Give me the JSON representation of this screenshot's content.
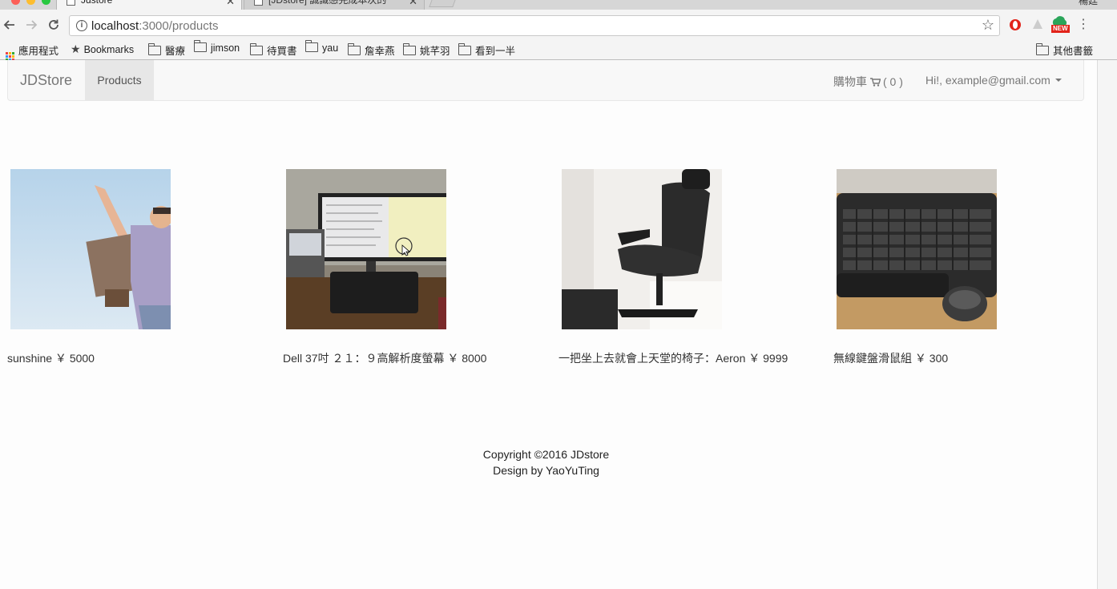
{
  "browser": {
    "tabs": [
      {
        "title": "Jdstore",
        "active": true
      },
      {
        "title": "[JDstore] 誠識感完成本次的",
        "active": false
      }
    ],
    "profile_label": "楊廷",
    "url_host": "localhost",
    "url_path": ":3000/products",
    "bookmarks": [
      {
        "label": "應用程式",
        "icon": "apps-icon"
      },
      {
        "label": "Bookmarks",
        "icon": "star-icon"
      },
      {
        "label": "醫療",
        "icon": "folder-icon"
      },
      {
        "label": "jimson",
        "icon": "folder-icon"
      },
      {
        "label": "待買書",
        "icon": "folder-icon"
      },
      {
        "label": "yau",
        "icon": "folder-icon"
      },
      {
        "label": "詹幸燕",
        "icon": "folder-icon"
      },
      {
        "label": "姚芊羽",
        "icon": "folder-icon"
      },
      {
        "label": "看到一半",
        "icon": "folder-icon"
      }
    ],
    "other_bookmarks": "其他書籤",
    "extension_badge": "NEW"
  },
  "navbar": {
    "brand": "JDStore",
    "products_link": "Products",
    "cart_label": "購物車",
    "cart_count": "( 0 )",
    "user_greeting": "Hi!, example@gmail.com"
  },
  "products": [
    {
      "caption": "sunshine ￥ 5000",
      "image": "kid-with-cardboard-wings"
    },
    {
      "caption": "Dell 37吋 ２１：９高解析度螢幕 ￥ 8000",
      "image": "monitor-and-keyboard-desk"
    },
    {
      "caption": "一把坐上去就會上天堂的椅子：Aeron ￥ 9999",
      "image": "black-office-chair"
    },
    {
      "caption": "無線鍵盤滑鼠組 ￥ 300",
      "image": "wireless-keyboard-and-mouse"
    }
  ],
  "footer": {
    "copyright": "Copyright ©2016 JDstore",
    "design": "Design by YaoYuTing"
  },
  "colors": {
    "navbar_bg": "#f8f8f8",
    "active_nav_bg": "#e7e7e7",
    "nav_text": "#777777",
    "page_bg": "#fdfdfd"
  }
}
